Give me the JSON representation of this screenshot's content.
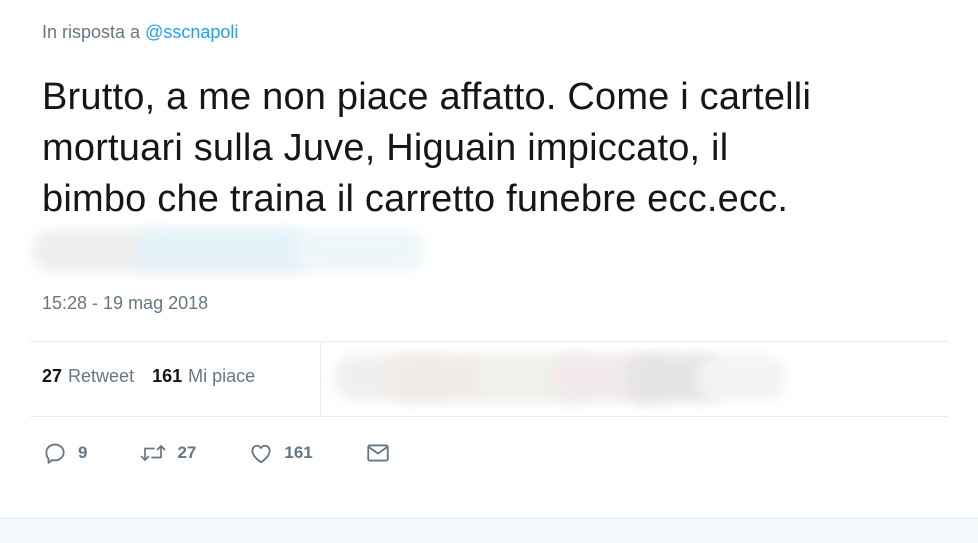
{
  "reply": {
    "prefix": "In risposta a",
    "mention": "@sscnapoli"
  },
  "tweet": {
    "lines": [
      "Brutto, a me non piace affatto. Come i cartelli",
      "mortuari sulla Juve, Higuain impiccato, il",
      "bimbo che traina il carretto funebre ecc.ecc."
    ],
    "timestamp": "15:28 - 19 mag 2018"
  },
  "stats": {
    "retweets_count": "27",
    "retweets_label": "Retweet",
    "likes_count": "161",
    "likes_label": "Mi piace"
  },
  "actions": {
    "reply_count": "9",
    "retweet_count": "27",
    "like_count": "161"
  },
  "colors": {
    "text": "#14171a",
    "secondary": "#657786",
    "link": "#1da1f2",
    "divider": "#e6ecf0"
  },
  "icons": [
    "reply-icon",
    "retweet-icon",
    "like-icon",
    "direct-message-icon"
  ]
}
